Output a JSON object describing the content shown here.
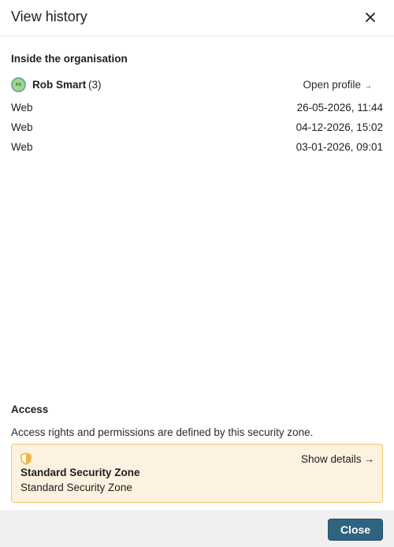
{
  "dialog": {
    "title": "View history",
    "close_icon": "close-icon"
  },
  "organisation": {
    "section_title": "Inside the organisation",
    "user": {
      "avatar_initials": "RS",
      "name": "Rob Smart",
      "count": "(3)",
      "open_profile_label": "Open profile",
      "open_profile_arrow": "→"
    },
    "history": [
      {
        "source": "Web",
        "timestamp": "26-05-2026, 11:44"
      },
      {
        "source": "Web",
        "timestamp": "04-12-2026, 15:02"
      },
      {
        "source": "Web",
        "timestamp": "03-01-2026, 09:01"
      }
    ]
  },
  "access": {
    "section_title": "Access",
    "description": "Access rights and permissions are defined by this security zone.",
    "zone": {
      "icon": "shield-icon",
      "show_details_label": "Show details",
      "show_details_arrow": "→",
      "name": "Standard Security Zone",
      "subtitle": "Standard Security Zone"
    }
  },
  "footer": {
    "close_label": "Close"
  },
  "colors": {
    "primary_button": "#2e6480",
    "zone_card_bg": "#fdf1df",
    "zone_card_border": "#f1c66b",
    "shield": "#f0b43c",
    "avatar": "#a6d58c"
  }
}
